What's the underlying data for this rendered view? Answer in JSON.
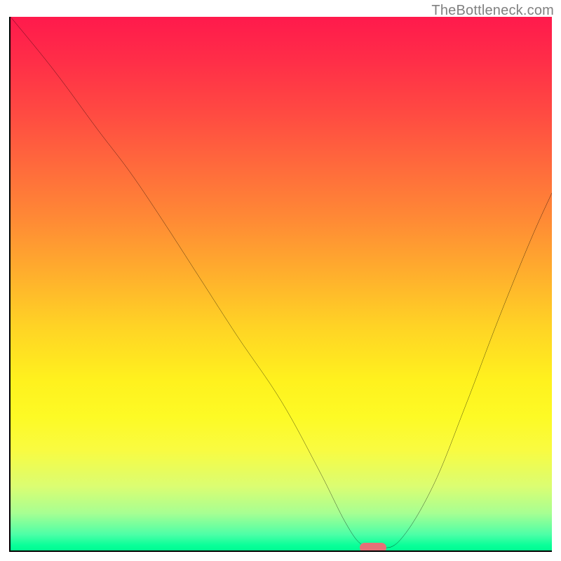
{
  "watermark": "TheBottleneck.com",
  "chart_data": {
    "type": "line",
    "title": "",
    "xlabel": "",
    "ylabel": "",
    "xlim": [
      0,
      100
    ],
    "ylim": [
      0,
      100
    ],
    "grid": false,
    "legend": false,
    "annotations": [],
    "background": {
      "type": "vertical-gradient",
      "description": "red at top through orange and yellow to green at bottom",
      "stops": [
        {
          "pos": 0,
          "color": "#ff1a4c"
        },
        {
          "pos": 18,
          "color": "#ff4a42"
        },
        {
          "pos": 38,
          "color": "#ff8a35"
        },
        {
          "pos": 58,
          "color": "#ffd325"
        },
        {
          "pos": 75,
          "color": "#fdfa25"
        },
        {
          "pos": 93,
          "color": "#a7ff92"
        },
        {
          "pos": 100,
          "color": "#00fc92"
        }
      ]
    },
    "series": [
      {
        "name": "bottleneck-curve",
        "color": "#000000",
        "x": [
          0,
          8,
          16,
          22,
          28,
          35,
          42,
          50,
          57,
          62,
          65,
          68,
          72,
          78,
          84,
          90,
          96,
          100
        ],
        "y": [
          100,
          90,
          79,
          71,
          62,
          51,
          40,
          28,
          15,
          5,
          1,
          0.5,
          2,
          12,
          27,
          43,
          58,
          67
        ]
      }
    ],
    "marker": {
      "name": "optimal-range",
      "shape": "pill",
      "color": "#e77077",
      "x": 67,
      "y": 0.5
    }
  }
}
